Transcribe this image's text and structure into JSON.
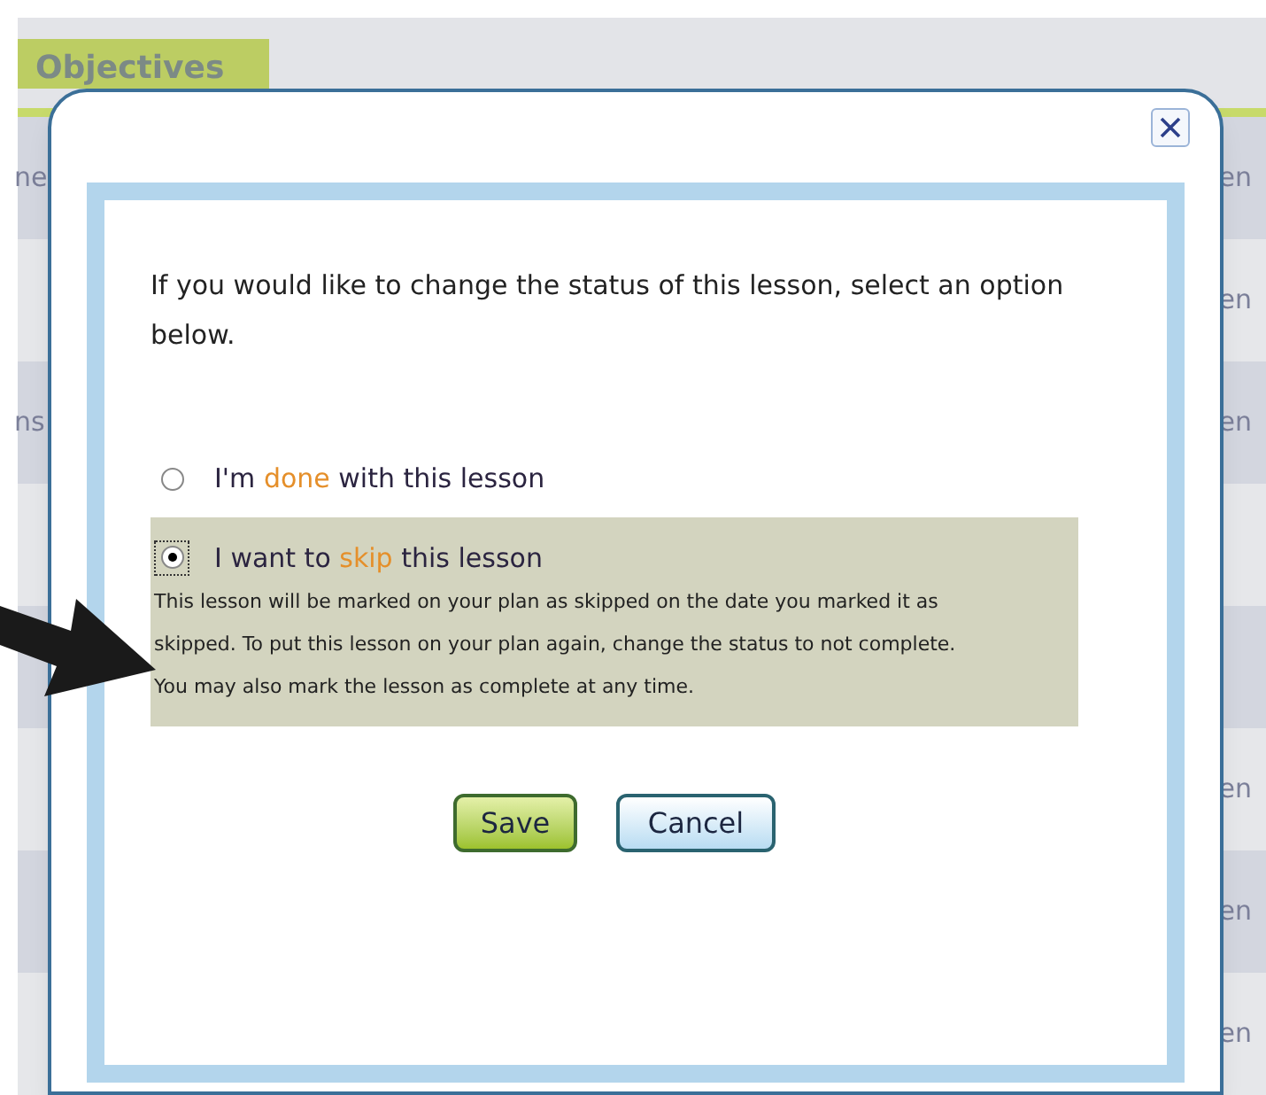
{
  "background": {
    "tab": "Objectives",
    "rows": [
      {
        "left": "ne",
        "right": "en"
      },
      {
        "right": "en"
      },
      {
        "left": "ns",
        "right": "en"
      },
      {},
      {},
      {
        "right": "en"
      },
      {
        "right": "en"
      },
      {
        "right": "en"
      }
    ]
  },
  "dialog": {
    "prompt": "If you would like to change the status of this lesson, select an option below.",
    "options": [
      {
        "selected": false,
        "parts": [
          {
            "text": "I'm "
          },
          {
            "text": "done",
            "highlight": true
          },
          {
            "text": " with this lesson"
          }
        ]
      },
      {
        "selected": true,
        "parts": [
          {
            "text": "I want to "
          },
          {
            "text": "skip",
            "highlight": true
          },
          {
            "text": " this lesson"
          }
        ],
        "description": "This lesson will be marked on your plan as skipped on the date you marked it as skipped. To put this lesson on your plan again, change the status to not complete. You may also mark the lesson as complete at any time."
      }
    ],
    "buttons": [
      {
        "kind": "primary",
        "label": "Save"
      },
      {
        "kind": "secondary",
        "label": "Cancel"
      }
    ]
  }
}
